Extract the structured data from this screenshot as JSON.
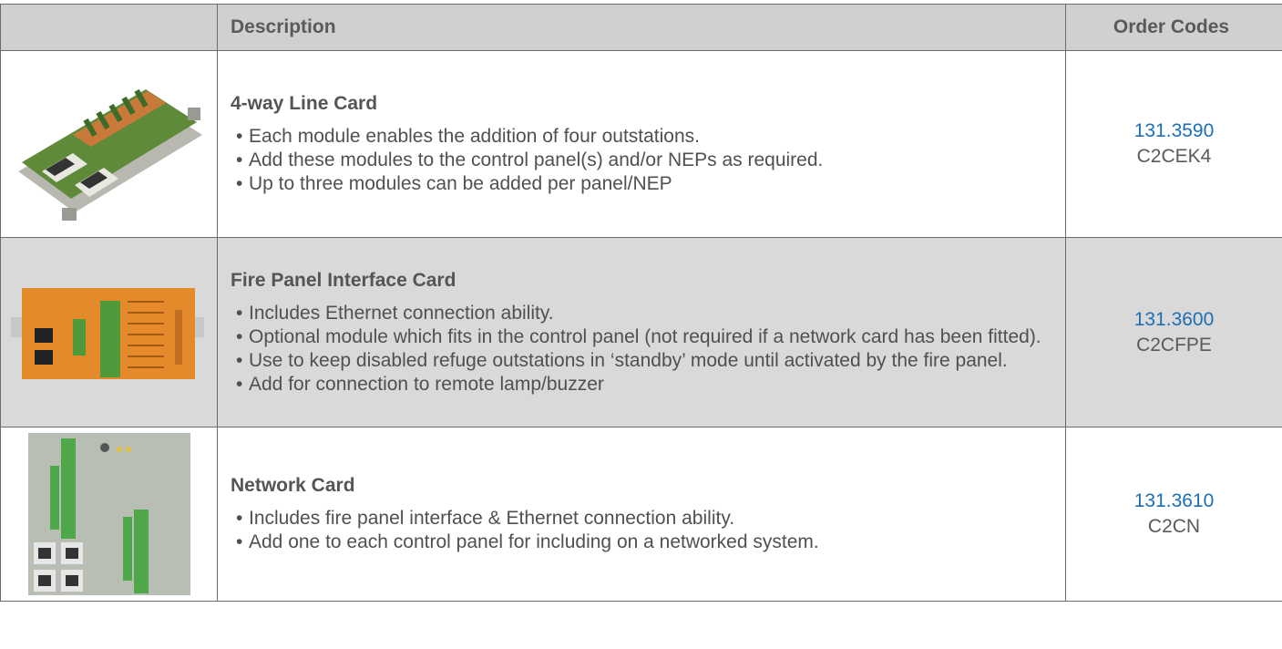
{
  "header": {
    "image_col": "",
    "description": "Description",
    "order_codes": "Order Codes"
  },
  "rows": [
    {
      "title": "4-way Line Card",
      "bullets": [
        "Each module enables the addition of four outstations.",
        "Add these modules to the control panel(s) and/or NEPs as required.",
        "Up to three modules can be added per panel/NEP"
      ],
      "code_number": "131.3590",
      "code_id": "C2CEK4"
    },
    {
      "title": "Fire Panel Interface Card",
      "bullets": [
        "Includes Ethernet connection ability.",
        "Optional module which fits in the control panel (not required if a network card has been fitted).",
        "Use to keep disabled refuge outstations in ‘standby’ mode until activated by the fire panel.",
        "Add for connection to remote lamp/buzzer"
      ],
      "code_number": "131.3600",
      "code_id": "C2CFPE"
    },
    {
      "title": "Network Card",
      "bullets": [
        "Includes fire panel interface & Ethernet connection ability.",
        "Add one to each control panel for including on a networked system."
      ],
      "code_number": "131.3610",
      "code_id": "C2CN"
    }
  ],
  "colors": {
    "header_bg": "#d0d0d0",
    "alt_row_bg": "#d9d9d9",
    "link_blue": "#1c6fb5",
    "border": "#6b6b6b"
  }
}
